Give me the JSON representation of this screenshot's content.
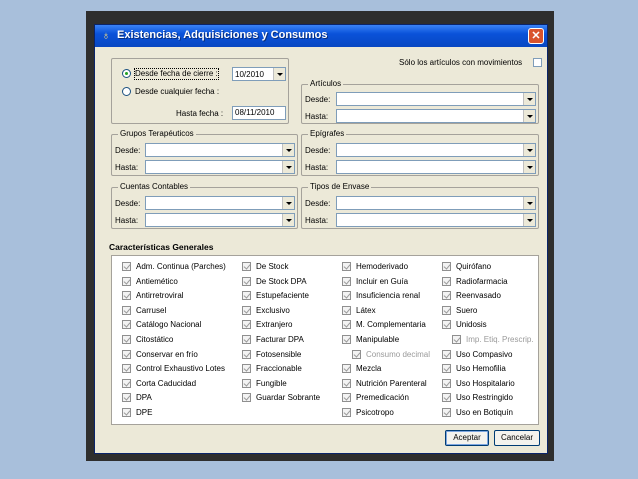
{
  "window": {
    "title": "Existencias, Adquisiciones y Consumos"
  },
  "top": {
    "only_with_movements_label": "Sólo los artículos con movimientos"
  },
  "date_filter": {
    "from_closing_label": "Desde fecha de cierre :",
    "from_closing_value": "10/2010",
    "from_any_label": "Desde cualquier fecha :",
    "to_date_label": "Hasta fecha :",
    "to_date_value": "08/11/2010",
    "selected": "from_closing"
  },
  "groups": {
    "articulos": {
      "title": "Artículos",
      "from_label": "Desde:",
      "to_label": "Hasta:"
    },
    "grupos_terapeuticos": {
      "title": "Grupos Terapéuticos",
      "from_label": "Desde:",
      "to_label": "Hasta:"
    },
    "epigrafes": {
      "title": "Epígrafes",
      "from_label": "Desde:",
      "to_label": "Hasta:"
    },
    "cuentas_contables": {
      "title": "Cuentas Contables",
      "from_label": "Desde:",
      "to_label": "Hasta:"
    },
    "tipos_envase": {
      "title": "Tipos de Envase",
      "from_label": "Desde:",
      "to_label": "Hasta:"
    }
  },
  "characteristics": {
    "title": "Características Generales",
    "col1": [
      "Adm. Continua (Parches)",
      "Antiemético",
      "Antirretroviral",
      "Carrusel",
      "Catálogo Nacional",
      "Citostático",
      "Conservar en frío",
      "Control Exhaustivo Lotes",
      "Corta Caducidad",
      "DPA",
      "DPE"
    ],
    "col2": [
      "De Stock",
      "De Stock DPA",
      "Estupefaciente",
      "Exclusivo",
      "Extranjero",
      "Facturar DPA",
      "Fotosensible",
      "Fraccionable",
      "Fungible",
      "Guardar Sobrante"
    ],
    "col3": [
      "Hemoderivado",
      "Incluir en Guía",
      "Insuficiencia renal",
      "Látex",
      "M. Complementaria",
      "Manipulable",
      "Consumo decimal",
      "Mezcla",
      "Nutrición Parenteral",
      "Premedicación",
      "Psicotropo"
    ],
    "col4": [
      "Quirófano",
      "Radiofarmacia",
      "Reenvasado",
      "Suero",
      "Unidosis",
      "Imp. Etiq. Prescrip.",
      "Uso Compasivo",
      "Uso Hemofilia",
      "Uso Hospitalario",
      "Uso Restringido",
      "Uso en Botiquín"
    ]
  },
  "buttons": {
    "accept": "Aceptar",
    "cancel": "Cancelar"
  }
}
